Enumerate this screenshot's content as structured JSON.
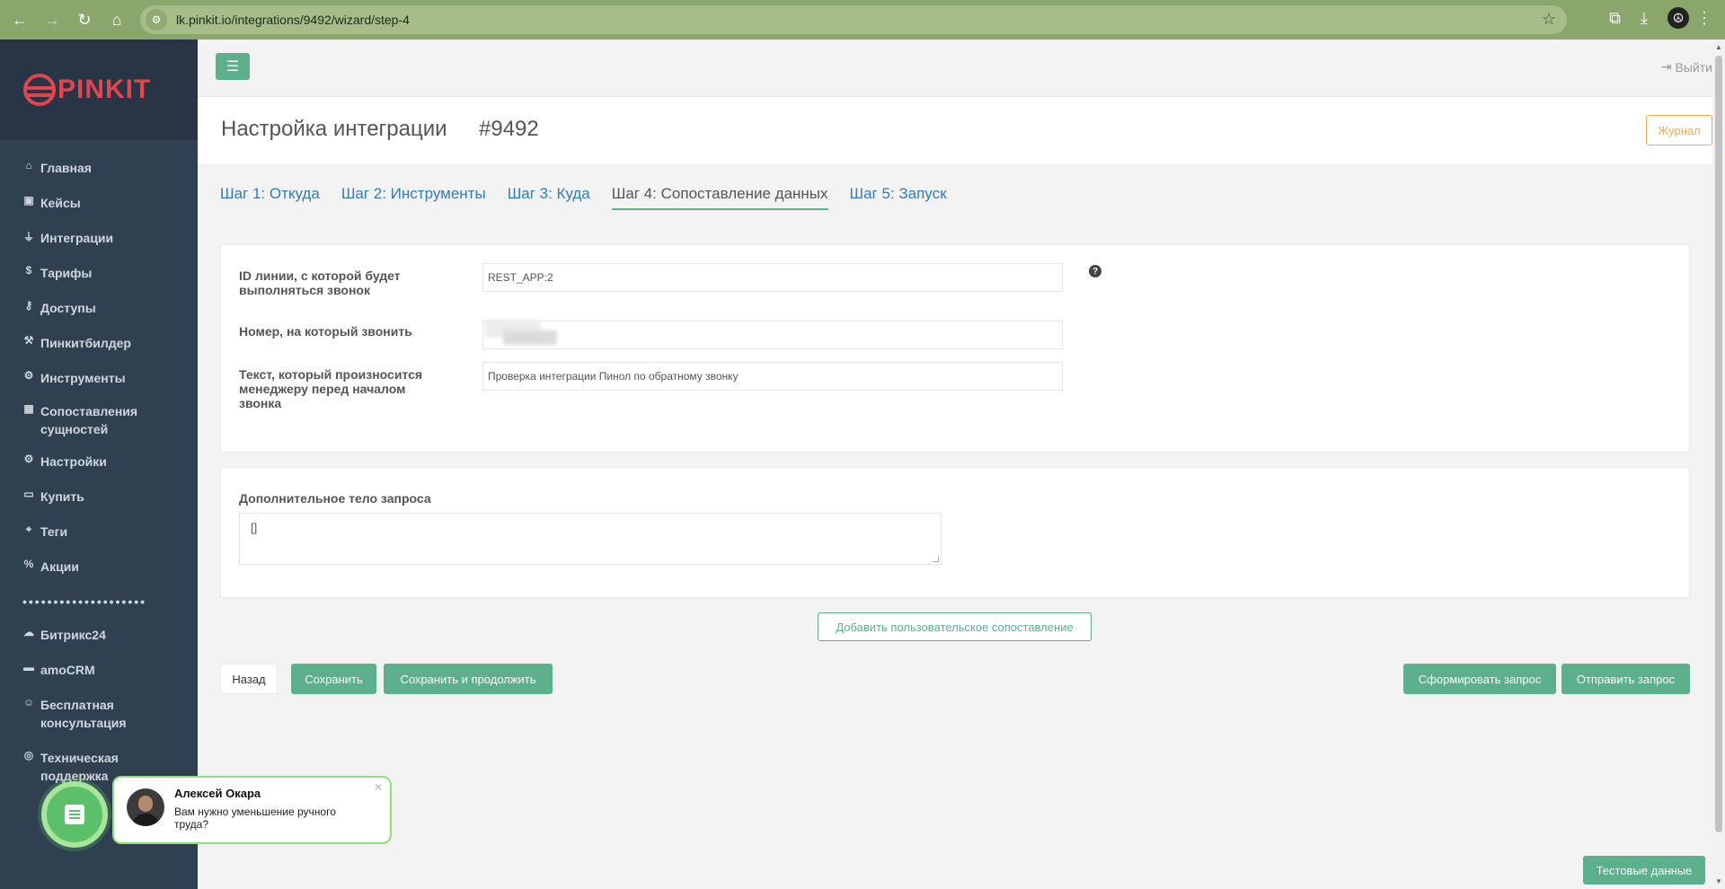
{
  "browser": {
    "url": "lk.pinkit.io/integrations/9492/wizard/step-4"
  },
  "sidebar": {
    "logo": "PINKIT",
    "items": [
      {
        "label": "Главная",
        "icon": "home-icon",
        "glyph": "⌂"
      },
      {
        "label": "Кейсы",
        "icon": "briefcase-icon",
        "glyph": "▣"
      },
      {
        "label": "Интеграции",
        "icon": "plug-icon",
        "glyph": "⏚"
      },
      {
        "label": "Тарифы",
        "icon": "dollar-icon",
        "glyph": "$"
      },
      {
        "label": "Доступы",
        "icon": "key-icon",
        "glyph": "⚷"
      },
      {
        "label": "Пинкитбилдер",
        "icon": "hammer-icon",
        "glyph": "⚒"
      },
      {
        "label": "Инструменты",
        "icon": "wrench-icon",
        "glyph": "⚙"
      },
      {
        "label": "Сопоставления сущностей",
        "icon": "table-icon",
        "glyph": "▦"
      },
      {
        "label": "Настройки",
        "icon": "gears-icon",
        "glyph": "⚙"
      },
      {
        "label": "Купить",
        "icon": "money-icon",
        "glyph": "▭"
      },
      {
        "label": "Теги",
        "icon": "tags-icon",
        "glyph": "⌖"
      },
      {
        "label": "Акции",
        "icon": "percent-icon",
        "glyph": "%"
      }
    ],
    "separator": "••••••••••••••••••••",
    "items2": [
      {
        "label": "Битрикс24",
        "icon": "cloud-icon",
        "glyph": "☁"
      },
      {
        "label": "amoCRM",
        "icon": "amocrm-icon",
        "glyph": "▬"
      },
      {
        "label": "Бесплатная консультация",
        "icon": "user-icon",
        "glyph": "☺"
      },
      {
        "label": "Техническая поддержка",
        "icon": "support-icon",
        "glyph": "◎"
      }
    ]
  },
  "topbar": {
    "logout": "Выйти"
  },
  "header": {
    "title": "Настройка интеграции",
    "number": "#9492",
    "journal": "Журнал"
  },
  "tabs": [
    {
      "label": "Шаг 1: Откуда",
      "active": false
    },
    {
      "label": "Шаг 2: Инструменты",
      "active": false
    },
    {
      "label": "Шаг 3: Куда",
      "active": false
    },
    {
      "label": "Шаг 4: Сопоставление данных",
      "active": true
    },
    {
      "label": "Шаг 5: Запуск",
      "active": false
    }
  ],
  "form": {
    "line_id_label": "ID линии, с которой будет выполняться звонок",
    "line_id_value": "REST_APP:2",
    "phone_label": "Номер, на который звонить",
    "phone_value": "",
    "text_label": "Текст, который произносится менеджеру перед началом звонка",
    "text_value": "Проверка интеграции Пинол по обратному звонку",
    "body_label": "Дополнительное тело запроса",
    "body_value": "[]"
  },
  "actions": {
    "add_mapping": "Добавить пользовательское сопоставление",
    "back": "Назад",
    "save": "Сохранить",
    "save_continue": "Сохранить и продолжить",
    "build_request": "Сформировать запрос",
    "send_request": "Отправить запрос",
    "test_data": "Тестовые данные"
  },
  "chat": {
    "name": "Алексей Окара",
    "message": "Вам нужно уменьшение ручного труда?"
  },
  "colors": {
    "accent_green": "#5cb08b",
    "sidebar_bg": "#2f4050",
    "link_blue": "#337ab7",
    "journal_orange": "#f0ad4e",
    "browser_bar": "#8aa66b"
  }
}
